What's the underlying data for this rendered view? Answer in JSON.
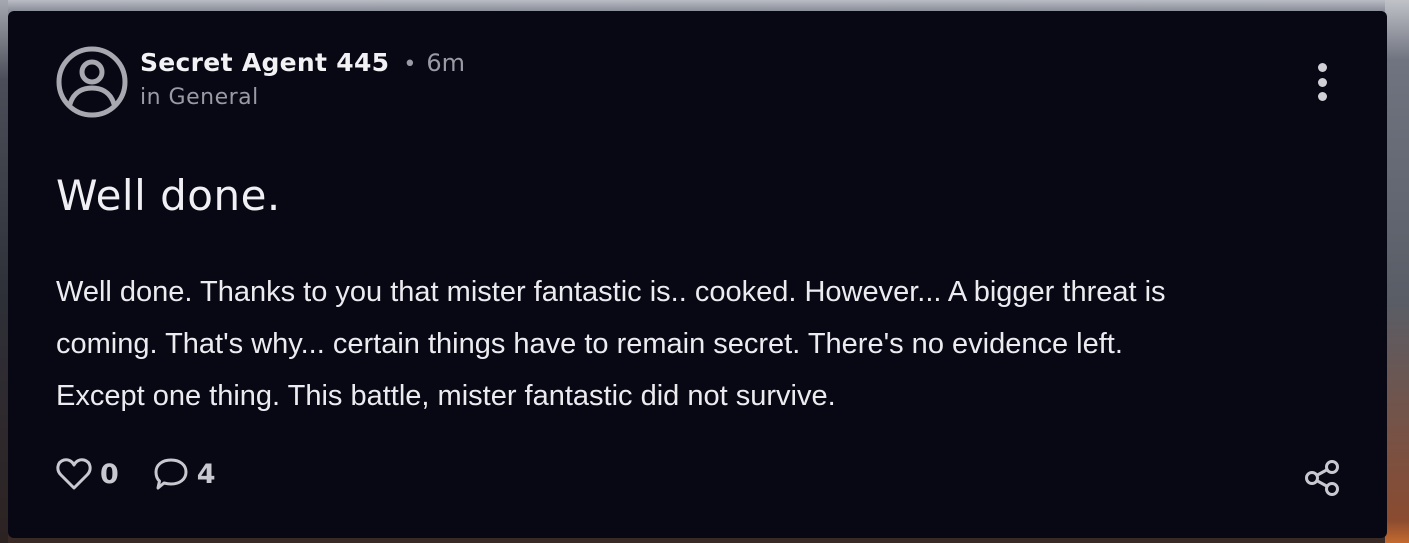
{
  "post": {
    "author": "Secret Agent 445",
    "separator": "•",
    "time_ago": "6m",
    "category": "in General",
    "title": "Well done.",
    "body_lines": [
      "Well done. Thanks to you that mister fantastic is.. cooked. However... A bigger threat is",
      "coming. That's why... certain things have to remain secret. There's no evidence left.",
      "Except one thing. This battle, mister fantastic did not survive."
    ],
    "likes": "0",
    "comments": "4"
  },
  "icons": {
    "avatar": "user-circle-icon",
    "more": "vertical-ellipsis-icon",
    "like": "heart-outline-icon",
    "comment": "speech-bubble-icon",
    "share": "share-nodes-icon"
  },
  "colors": {
    "card_background": "#080815",
    "primary_text": "#f2f2f5",
    "secondary_text": "#9a9aa4",
    "icon": "#c8c8d0"
  }
}
